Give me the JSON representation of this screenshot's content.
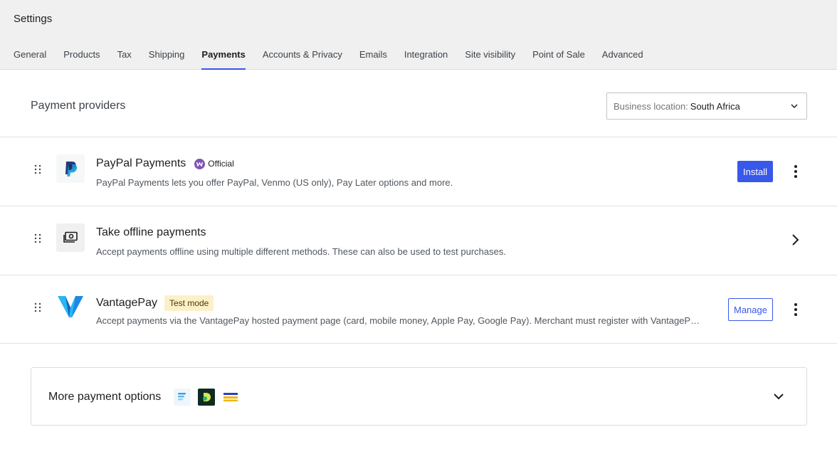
{
  "header": {
    "title": "Settings",
    "tabs": [
      {
        "label": "General",
        "active": false
      },
      {
        "label": "Products",
        "active": false
      },
      {
        "label": "Tax",
        "active": false
      },
      {
        "label": "Shipping",
        "active": false
      },
      {
        "label": "Payments",
        "active": true
      },
      {
        "label": "Accounts & Privacy",
        "active": false
      },
      {
        "label": "Emails",
        "active": false
      },
      {
        "label": "Integration",
        "active": false
      },
      {
        "label": "Site visibility",
        "active": false
      },
      {
        "label": "Point of Sale",
        "active": false
      },
      {
        "label": "Advanced",
        "active": false
      }
    ]
  },
  "main": {
    "section_title": "Payment providers",
    "location": {
      "label": "Business location:",
      "value": "South Africa"
    },
    "providers": [
      {
        "name": "PayPal Payments",
        "badge": "Official",
        "description": "PayPal Payments lets you offer PayPal, Venmo (US only), Pay Later options and more.",
        "action": "Install"
      },
      {
        "name": "Take offline payments",
        "description": "Accept payments offline using multiple different methods. These can also be used to test purchases."
      },
      {
        "name": "VantagePay",
        "badge": "Test mode",
        "description": "Accept payments via the VantagePay hosted payment page (card, mobile money, Apple Pay, Google Pay). Merchant must register with VantagePay...",
        "action": "Manage"
      }
    ],
    "more_options": {
      "label": "More payment options"
    }
  },
  "colors": {
    "accent": "#3858e9",
    "official": "#7f54b3",
    "test_badge": "#fcf0c8"
  },
  "icons": [
    "chevron-down-icon",
    "drag-handle-icon",
    "paypal-logo",
    "cash-icon",
    "vantagepay-logo",
    "kebab-menu-icon",
    "chevron-right-icon"
  ]
}
